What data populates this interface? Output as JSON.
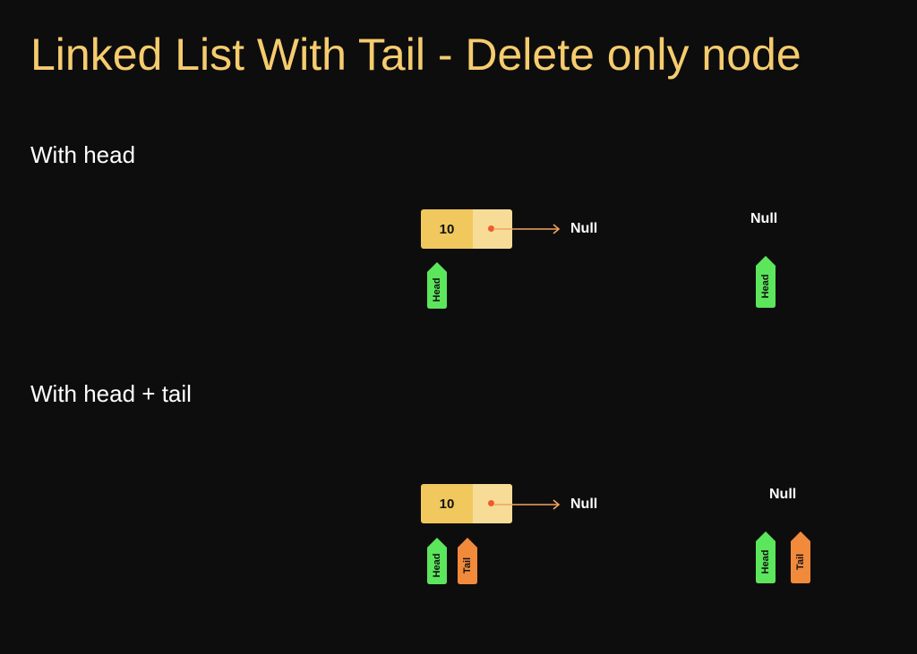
{
  "title": "Linked List With Tail - Delete only node",
  "sections": [
    {
      "label": "With head",
      "node_value": "10",
      "null_label": "Null",
      "after_null_label": "Null",
      "head_tag": "Head"
    },
    {
      "label": "With head + tail",
      "node_value": "10",
      "null_label": "Null",
      "after_null_label": "Null",
      "head_tag": "Head",
      "tail_tag": "Tail"
    }
  ],
  "colors": {
    "background": "#0e0d0e",
    "title": "#f5cc6e",
    "node_data": "#f1c85e",
    "node_next": "#f6dc97",
    "pointer": "#ef5a2d",
    "arrow": "#f1a35e",
    "head_tag": "#5ce65c",
    "tail_tag": "#f28a3c"
  }
}
